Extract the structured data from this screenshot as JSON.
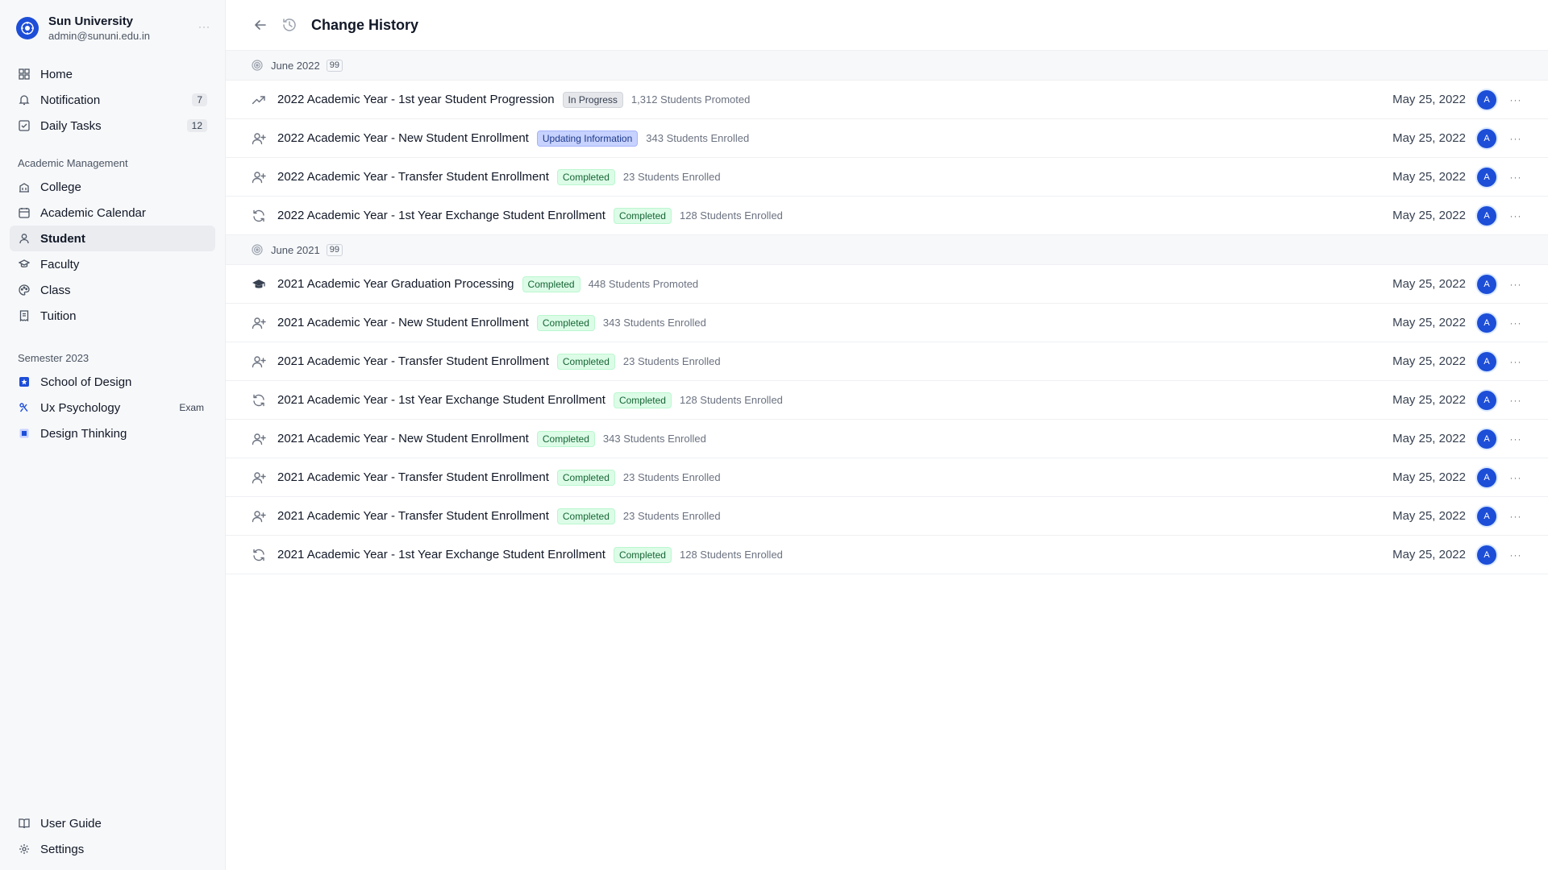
{
  "org": {
    "name": "Sun University",
    "email": "admin@sununi.edu.in",
    "more": "···"
  },
  "nav": {
    "top": [
      {
        "label": "Home",
        "icon": "grid-icon"
      },
      {
        "label": "Notification",
        "icon": "bell-icon",
        "badge": "7"
      },
      {
        "label": "Daily Tasks",
        "icon": "checkbox-icon",
        "badge": "12"
      }
    ],
    "academic_title": "Academic Management",
    "academic": [
      {
        "label": "College",
        "icon": "building-icon"
      },
      {
        "label": "Academic Calendar",
        "icon": "calendar-icon"
      },
      {
        "label": "Student",
        "icon": "user-icon",
        "active": true
      },
      {
        "label": "Faculty",
        "icon": "graduation-icon"
      },
      {
        "label": "Class",
        "icon": "palette-icon"
      },
      {
        "label": "Tuition",
        "icon": "receipt-icon"
      }
    ],
    "semester_title": "Semester 2023",
    "semester": [
      {
        "label": "School of Design",
        "icon": "design-school-icon"
      },
      {
        "label": "Ux Psychology",
        "icon": "psychology-icon",
        "tag": "Exam"
      },
      {
        "label": "Design Thinking",
        "icon": "design-thinking-icon"
      }
    ],
    "bottom": [
      {
        "label": "User Guide",
        "icon": "book-icon"
      },
      {
        "label": "Settings",
        "icon": "gear-icon"
      }
    ]
  },
  "header": {
    "title": "Change History"
  },
  "groups": [
    {
      "label": "June 2022",
      "count": "99",
      "rows": [
        {
          "icon": "trend-up-icon",
          "title": "2022 Academic Year - 1st year Student Progression",
          "status": "In Progress",
          "status_kind": "progress",
          "meta": "1,312 Students Promoted",
          "date": "May 25, 2022",
          "avatar": "A"
        },
        {
          "icon": "user-plus-icon",
          "title": "2022 Academic Year - New Student Enrollment",
          "status": "Updating Information",
          "status_kind": "updating",
          "meta": "343 Students Enrolled",
          "date": "May 25, 2022",
          "avatar": "A"
        },
        {
          "icon": "user-plus-icon",
          "title": "2022 Academic Year - Transfer Student Enrollment",
          "status": "Completed",
          "status_kind": "completed",
          "meta": "23 Students Enrolled",
          "date": "May 25, 2022",
          "avatar": "A"
        },
        {
          "icon": "refresh-icon",
          "title": "2022 Academic Year - 1st Year Exchange Student Enrollment",
          "status": "Completed",
          "status_kind": "completed",
          "meta": "128 Students Enrolled",
          "date": "May 25, 2022",
          "avatar": "A"
        }
      ]
    },
    {
      "label": "June 2021",
      "count": "99",
      "rows": [
        {
          "icon": "graduation-cap-icon",
          "title": "2021 Academic Year  Graduation Processing",
          "status": "Completed",
          "status_kind": "completed",
          "meta": "448 Students Promoted",
          "date": "May 25, 2022",
          "avatar": "A"
        },
        {
          "icon": "user-plus-icon",
          "title": "2021 Academic Year - New Student Enrollment",
          "status": "Completed",
          "status_kind": "completed",
          "meta": "343 Students Enrolled",
          "date": "May 25, 2022",
          "avatar": "A"
        },
        {
          "icon": "user-plus-icon",
          "title": "2021 Academic Year - Transfer Student Enrollment",
          "status": "Completed",
          "status_kind": "completed",
          "meta": "23 Students Enrolled",
          "date": "May 25, 2022",
          "avatar": "A"
        },
        {
          "icon": "refresh-icon",
          "title": "2021 Academic Year - 1st Year Exchange Student Enrollment",
          "status": "Completed",
          "status_kind": "completed",
          "meta": "128 Students Enrolled",
          "date": "May 25, 2022",
          "avatar": "A"
        },
        {
          "icon": "user-plus-icon",
          "title": "2021 Academic Year - New Student Enrollment",
          "status": "Completed",
          "status_kind": "completed",
          "meta": "343 Students Enrolled",
          "date": "May 25, 2022",
          "avatar": "A"
        },
        {
          "icon": "user-plus-icon",
          "title": "2021 Academic Year - Transfer Student Enrollment",
          "status": "Completed",
          "status_kind": "completed",
          "meta": "23 Students Enrolled",
          "date": "May 25, 2022",
          "avatar": "A"
        },
        {
          "icon": "user-plus-icon",
          "title": "2021 Academic Year - Transfer Student Enrollment",
          "status": "Completed",
          "status_kind": "completed",
          "meta": "23 Students Enrolled",
          "date": "May 25, 2022",
          "avatar": "A"
        },
        {
          "icon": "refresh-icon",
          "title": "2021 Academic Year - 1st Year Exchange Student Enrollment",
          "status": "Completed",
          "status_kind": "completed",
          "meta": "128 Students Enrolled",
          "date": "May 25, 2022",
          "avatar": "A"
        }
      ]
    }
  ],
  "colors": {
    "accent": "#1d4ed8",
    "completed_bg": "#dcfce7",
    "completed_text": "#166534",
    "updating_bg": "#c7d2fe",
    "progress_bg": "#e5e7eb"
  }
}
